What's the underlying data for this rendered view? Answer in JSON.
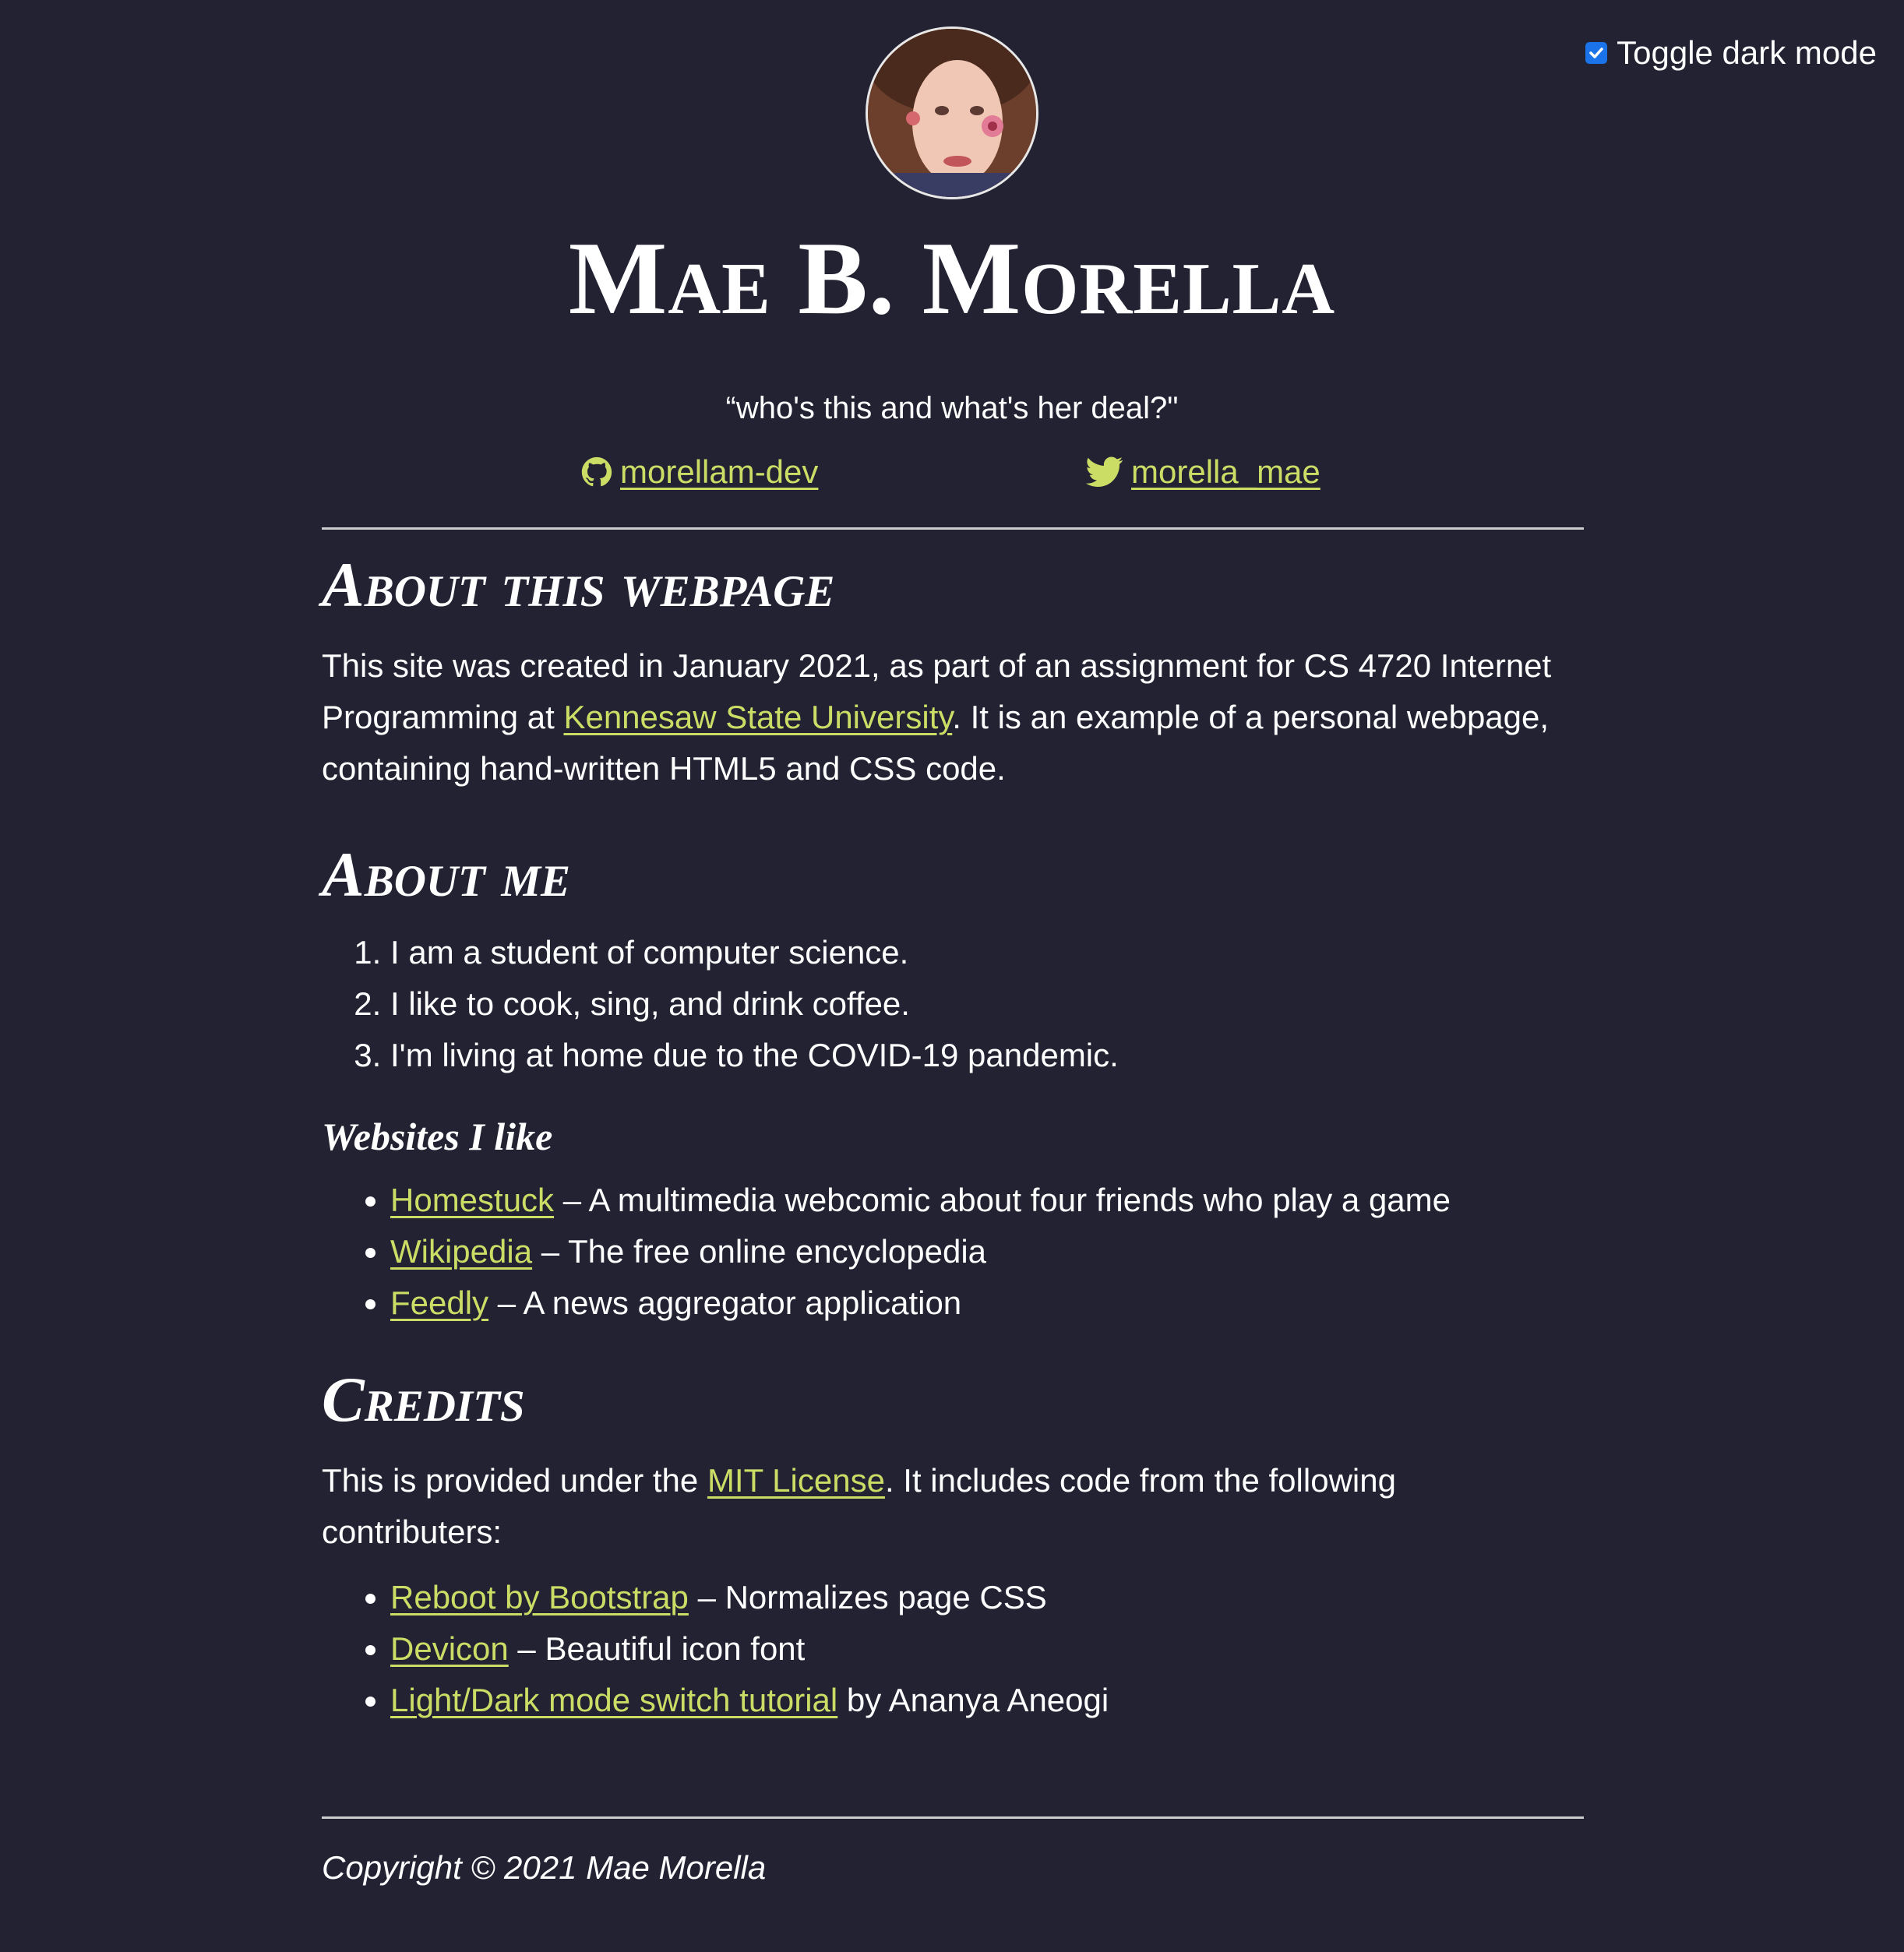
{
  "toggle": {
    "label": "Toggle dark mode",
    "checked": true
  },
  "header": {
    "title": "Mae B. Morella",
    "tagline": "“who's this and what's her deal?\""
  },
  "social": {
    "github": {
      "icon": "github-icon",
      "label": "morellam-dev"
    },
    "twitter": {
      "icon": "twitter-icon",
      "label": "morella_mae"
    }
  },
  "about_page": {
    "heading": "About this webpage",
    "text_1": "This site was created in January 2021, as part of an assignment for CS 4720 Internet Programming at ",
    "link": "Kennesaw State University",
    "text_2": ". It is an example of a personal webpage, containing hand-written HTML5 and CSS code."
  },
  "about_me": {
    "heading": "About me",
    "items": [
      "I am a student of computer science.",
      "I like to cook, sing, and drink coffee.",
      "I'm living at home due to the COVID-19 pandemic."
    ]
  },
  "websites": {
    "heading": "Websites I like",
    "items": [
      {
        "link": "Homestuck",
        "desc": " – A multimedia webcomic about four friends who play a game"
      },
      {
        "link": "Wikipedia",
        "desc": " – The free online encyclopedia"
      },
      {
        "link": "Feedly",
        "desc": " – A news aggregator application"
      }
    ]
  },
  "credits": {
    "heading": "Credits",
    "text_1": "This is provided under the ",
    "link": "MIT License",
    "text_2": ". It includes code from the following contributers:",
    "items": [
      {
        "link": "Reboot by Bootstrap",
        "desc": " – Normalizes page CSS"
      },
      {
        "link": "Devicon",
        "desc": " – Beautiful icon font"
      },
      {
        "link": "Light/Dark mode switch tutorial",
        "desc": " by Ananya Aneogi"
      }
    ]
  },
  "footer": {
    "copyright": "Copyright © 2021 Mae Morella"
  },
  "colors": {
    "background": "#222233",
    "text": "#ffffff",
    "link": "#ccdd66"
  }
}
